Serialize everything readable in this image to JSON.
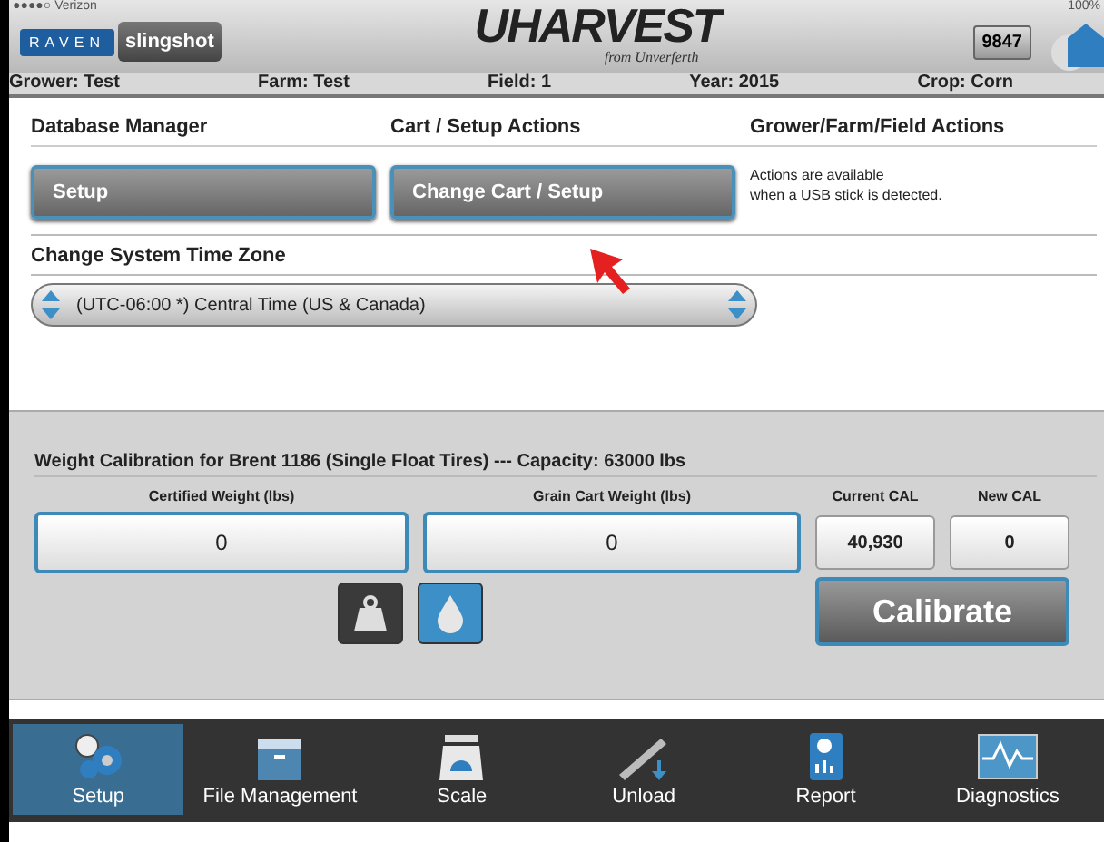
{
  "status_bar": {
    "carrier": "●●●●○ Verizon",
    "battery": "100%"
  },
  "header": {
    "brand_left": "RAVEN",
    "brand_right": "slingshot",
    "logo": "UHARVEST",
    "logo_subtitle": "from Unverferth",
    "unit_number": "9847"
  },
  "info_bar": [
    "Grower: Test",
    "Farm: Test",
    "Field: 1",
    "Year: 2015",
    "Crop: Corn"
  ],
  "actions": [
    {
      "heading": "Database Manager",
      "kind": "button",
      "text": "Setup"
    },
    {
      "heading": "Cart / Setup Actions",
      "kind": "button",
      "text": "Change Cart / Setup"
    },
    {
      "heading": "Grower/Farm/Field Actions",
      "kind": "note",
      "text": "Actions are available\nwhen a USB stick is detected."
    }
  ],
  "time_zone": {
    "heading": "Change System Time Zone",
    "value": "(UTC-06:00 *) Central Time (US & Canada)"
  },
  "calibration": {
    "title": "Weight Calibration for Brent 1186 (Single Float Tires) --- Capacity: 63000 lbs",
    "fields": [
      {
        "label": "Certified Weight (lbs)",
        "value": "0",
        "kind": "input"
      },
      {
        "label": "Grain Cart Weight (lbs)",
        "value": "0",
        "kind": "input"
      },
      {
        "label": "Current CAL",
        "value": "40,930",
        "kind": "readout"
      },
      {
        "label": "New CAL",
        "value": "0",
        "kind": "readout"
      }
    ],
    "modes": [
      {
        "kind": "weight",
        "selected": true
      },
      {
        "kind": "moisture",
        "selected": false
      }
    ],
    "calibrate": "Calibrate"
  },
  "nav": [
    {
      "label": "Setup",
      "kind": "gears",
      "selected": true
    },
    {
      "label": "File Management",
      "kind": "cabinet",
      "selected": false
    },
    {
      "label": "Scale",
      "kind": "scale",
      "selected": false
    },
    {
      "label": "Unload",
      "kind": "auger",
      "selected": false
    },
    {
      "label": "Report",
      "kind": "report",
      "selected": false
    },
    {
      "label": "Diagnostics",
      "kind": "chart",
      "selected": false
    }
  ]
}
